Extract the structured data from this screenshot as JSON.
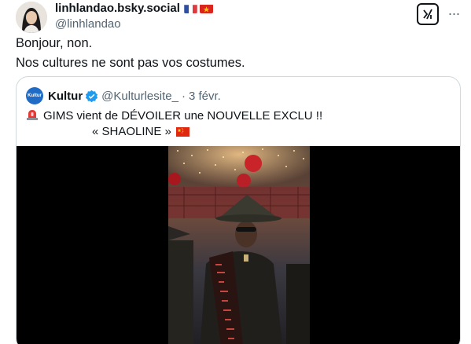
{
  "post": {
    "display_name": "linhlandao.bsky.social",
    "handle": "@linhlandao",
    "flags": [
      "france-flag",
      "vietnam-flag"
    ],
    "lines": [
      "Bonjour, non.",
      "Nos cultures ne sont pas vos costumes."
    ]
  },
  "quoted": {
    "avatar_text": "Kultur",
    "name": "Kultur",
    "handle": "@Kulturlesite_",
    "separator": "·",
    "date": "3 févr.",
    "line1": "GIMS vient de DÉVOILER une NOUVELLE EXCLU !!",
    "line2": "« SHAOLINE »"
  },
  "icons": {
    "more": "···"
  },
  "colors": {
    "text": "#0f1419",
    "secondary": "#536471",
    "border": "#cfd9de",
    "verified": "#1d9bf0"
  }
}
